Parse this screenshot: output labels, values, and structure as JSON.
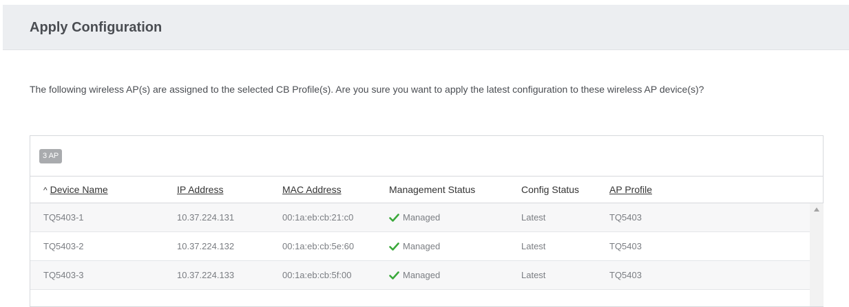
{
  "dialog": {
    "title": "Apply Configuration",
    "description": "The following wireless AP(s) are assigned to the selected CB Profile(s). Are you sure you want to apply the latest configuration to these wireless AP device(s)?"
  },
  "table": {
    "count_badge": "3 AP",
    "sort_indicator": "^",
    "columns": {
      "device_name": "Device Name",
      "ip_address": "IP Address",
      "mac_address": "MAC Address",
      "management_status": "Management Status",
      "config_status": "Config Status",
      "ap_profile": "AP Profile"
    },
    "rows": [
      {
        "device_name": "TQ5403-1",
        "ip": "10.37.224.131",
        "mac": "00:1a:eb:cb:21:c0",
        "mgmt": "Managed",
        "config": "Latest",
        "profile": "TQ5403"
      },
      {
        "device_name": "TQ5403-2",
        "ip": "10.37.224.132",
        "mac": "00:1a:eb:cb:5e:60",
        "mgmt": "Managed",
        "config": "Latest",
        "profile": "TQ5403"
      },
      {
        "device_name": "TQ5403-3",
        "ip": "10.37.224.133",
        "mac": "00:1a:eb:cb:5f:00",
        "mgmt": "Managed",
        "config": "Latest",
        "profile": "TQ5403"
      }
    ]
  },
  "colors": {
    "accent_check": "#3aa83a",
    "header_bg": "#eceef1"
  },
  "icons": {
    "sort": "caret-up-icon",
    "status": "check-icon",
    "scroll": "scroll-up-arrow-icon"
  }
}
